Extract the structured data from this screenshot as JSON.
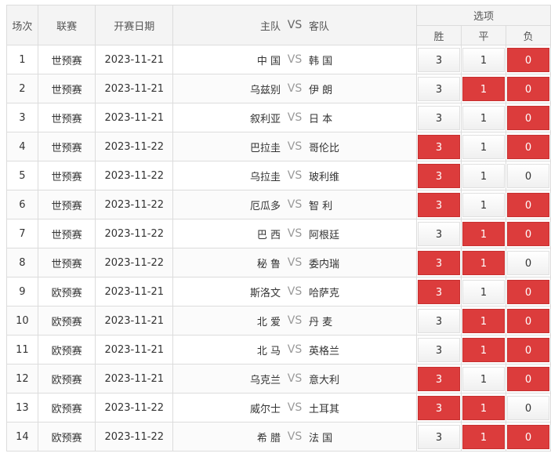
{
  "header": {
    "round": "场次",
    "league": "联赛",
    "date": "开赛日期",
    "home": "主队",
    "vs": "VS",
    "away": "客队",
    "options": "选项",
    "win": "胜",
    "draw": "平",
    "lose": "负"
  },
  "colors": {
    "selected": "#dc3c3c",
    "header_bg": "#f4f4f4",
    "border": "#dcdcdc"
  },
  "rows": [
    {
      "n": "1",
      "league": "世预赛",
      "date": "2023-11-21",
      "home": "中 国",
      "vs": "VS",
      "away": "韩 国",
      "o": [
        "3",
        "1",
        "0"
      ],
      "sel": [
        false,
        false,
        true
      ]
    },
    {
      "n": "2",
      "league": "世预赛",
      "date": "2023-11-21",
      "home": "乌兹别",
      "vs": "VS",
      "away": "伊 朗",
      "o": [
        "3",
        "1",
        "0"
      ],
      "sel": [
        false,
        true,
        true
      ]
    },
    {
      "n": "3",
      "league": "世预赛",
      "date": "2023-11-21",
      "home": "叙利亚",
      "vs": "VS",
      "away": "日 本",
      "o": [
        "3",
        "1",
        "0"
      ],
      "sel": [
        false,
        false,
        true
      ]
    },
    {
      "n": "4",
      "league": "世预赛",
      "date": "2023-11-22",
      "home": "巴拉圭",
      "vs": "VS",
      "away": "哥伦比",
      "o": [
        "3",
        "1",
        "0"
      ],
      "sel": [
        true,
        false,
        true
      ]
    },
    {
      "n": "5",
      "league": "世预赛",
      "date": "2023-11-22",
      "home": "乌拉圭",
      "vs": "VS",
      "away": "玻利维",
      "o": [
        "3",
        "1",
        "0"
      ],
      "sel": [
        true,
        false,
        false
      ]
    },
    {
      "n": "6",
      "league": "世预赛",
      "date": "2023-11-22",
      "home": "厄瓜多",
      "vs": "VS",
      "away": "智 利",
      "o": [
        "3",
        "1",
        "0"
      ],
      "sel": [
        true,
        false,
        true
      ]
    },
    {
      "n": "7",
      "league": "世预赛",
      "date": "2023-11-22",
      "home": "巴 西",
      "vs": "VS",
      "away": "阿根廷",
      "o": [
        "3",
        "1",
        "0"
      ],
      "sel": [
        false,
        true,
        true
      ]
    },
    {
      "n": "8",
      "league": "世预赛",
      "date": "2023-11-22",
      "home": "秘 鲁",
      "vs": "VS",
      "away": "委内瑞",
      "o": [
        "3",
        "1",
        "0"
      ],
      "sel": [
        true,
        true,
        false
      ]
    },
    {
      "n": "9",
      "league": "欧预赛",
      "date": "2023-11-21",
      "home": "斯洛文",
      "vs": "VS",
      "away": "哈萨克",
      "o": [
        "3",
        "1",
        "0"
      ],
      "sel": [
        true,
        false,
        true
      ]
    },
    {
      "n": "10",
      "league": "欧预赛",
      "date": "2023-11-21",
      "home": "北 爱",
      "vs": "VS",
      "away": "丹 麦",
      "o": [
        "3",
        "1",
        "0"
      ],
      "sel": [
        false,
        true,
        true
      ]
    },
    {
      "n": "11",
      "league": "欧预赛",
      "date": "2023-11-21",
      "home": "北 马",
      "vs": "VS",
      "away": "英格兰",
      "o": [
        "3",
        "1",
        "0"
      ],
      "sel": [
        false,
        true,
        true
      ]
    },
    {
      "n": "12",
      "league": "欧预赛",
      "date": "2023-11-21",
      "home": "乌克兰",
      "vs": "VS",
      "away": "意大利",
      "o": [
        "3",
        "1",
        "0"
      ],
      "sel": [
        true,
        false,
        true
      ]
    },
    {
      "n": "13",
      "league": "欧预赛",
      "date": "2023-11-22",
      "home": "威尔士",
      "vs": "VS",
      "away": "土耳其",
      "o": [
        "3",
        "1",
        "0"
      ],
      "sel": [
        true,
        true,
        false
      ]
    },
    {
      "n": "14",
      "league": "欧预赛",
      "date": "2023-11-22",
      "home": "希 腊",
      "vs": "VS",
      "away": "法 国",
      "o": [
        "3",
        "1",
        "0"
      ],
      "sel": [
        false,
        true,
        true
      ]
    }
  ]
}
